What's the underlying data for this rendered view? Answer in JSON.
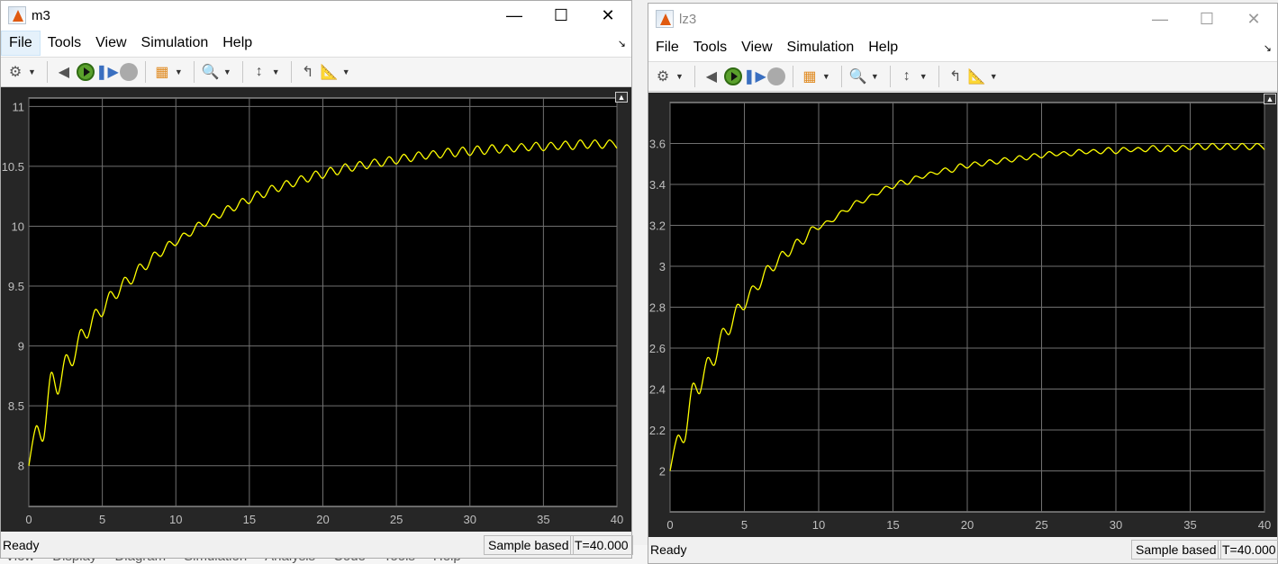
{
  "background_menu": [
    "View",
    "Display",
    "Diagram",
    "Simulation",
    "Analysis",
    "Code",
    "Tools",
    "Help"
  ],
  "menu": [
    "File",
    "Tools",
    "View",
    "Simulation",
    "Help"
  ],
  "colors": {
    "plot_bg": "#000000",
    "panel_bg": "#262626",
    "grid": "#707070",
    "line": "#ffff00"
  },
  "windows": [
    {
      "title": "m3",
      "status": "Ready",
      "mode": "Sample based",
      "time": "T=40.000"
    },
    {
      "title": "lz3",
      "status": "Ready",
      "mode": "Sample based",
      "time": "T=40.000"
    }
  ],
  "chart_data": [
    {
      "type": "line",
      "xlim": [
        0,
        40
      ],
      "ylim": [
        7.66,
        11.07
      ],
      "grid": true,
      "xticks": [
        0,
        5,
        10,
        15,
        20,
        25,
        30,
        35,
        40
      ],
      "yticks": [
        8,
        8.5,
        9,
        9.5,
        10,
        10.5,
        11
      ],
      "x_step": 0.5,
      "y": [
        8.0,
        8.33,
        8.22,
        8.77,
        8.6,
        8.92,
        8.84,
        9.13,
        9.07,
        9.3,
        9.25,
        9.45,
        9.4,
        9.57,
        9.52,
        9.68,
        9.64,
        9.78,
        9.75,
        9.87,
        9.84,
        9.94,
        9.92,
        10.03,
        10.0,
        10.1,
        10.07,
        10.17,
        10.13,
        10.23,
        10.19,
        10.29,
        10.24,
        10.34,
        10.29,
        10.38,
        10.33,
        10.42,
        10.37,
        10.46,
        10.4,
        10.49,
        10.43,
        10.52,
        10.46,
        10.54,
        10.48,
        10.56,
        10.5,
        10.58,
        10.52,
        10.6,
        10.54,
        10.62,
        10.56,
        10.63,
        10.57,
        10.65,
        10.58,
        10.66,
        10.59,
        10.67,
        10.6,
        10.68,
        10.61,
        10.68,
        10.62,
        10.69,
        10.63,
        10.7,
        10.63,
        10.7,
        10.64,
        10.71,
        10.64,
        10.72,
        10.65,
        10.72,
        10.65,
        10.72,
        10.65
      ]
    },
    {
      "type": "line",
      "xlim": [
        0,
        40
      ],
      "ylim": [
        1.8,
        3.8
      ],
      "grid": true,
      "xticks": [
        0,
        5,
        10,
        15,
        20,
        25,
        30,
        35,
        40
      ],
      "yticks": [
        2,
        2.2,
        2.4,
        2.6,
        2.8,
        3,
        3.2,
        3.4,
        3.6
      ],
      "x_step": 0.5,
      "y": [
        2.0,
        2.17,
        2.15,
        2.42,
        2.38,
        2.55,
        2.52,
        2.69,
        2.67,
        2.81,
        2.79,
        2.9,
        2.89,
        3.0,
        2.98,
        3.07,
        3.05,
        3.13,
        3.11,
        3.19,
        3.18,
        3.22,
        3.22,
        3.27,
        3.27,
        3.32,
        3.31,
        3.35,
        3.35,
        3.39,
        3.38,
        3.42,
        3.4,
        3.44,
        3.43,
        3.46,
        3.45,
        3.48,
        3.46,
        3.5,
        3.48,
        3.51,
        3.49,
        3.52,
        3.5,
        3.53,
        3.51,
        3.54,
        3.52,
        3.55,
        3.53,
        3.56,
        3.54,
        3.56,
        3.54,
        3.57,
        3.55,
        3.57,
        3.55,
        3.58,
        3.55,
        3.58,
        3.56,
        3.58,
        3.56,
        3.59,
        3.56,
        3.59,
        3.56,
        3.59,
        3.57,
        3.6,
        3.57,
        3.6,
        3.57,
        3.6,
        3.57,
        3.6,
        3.57,
        3.6,
        3.57
      ]
    }
  ]
}
